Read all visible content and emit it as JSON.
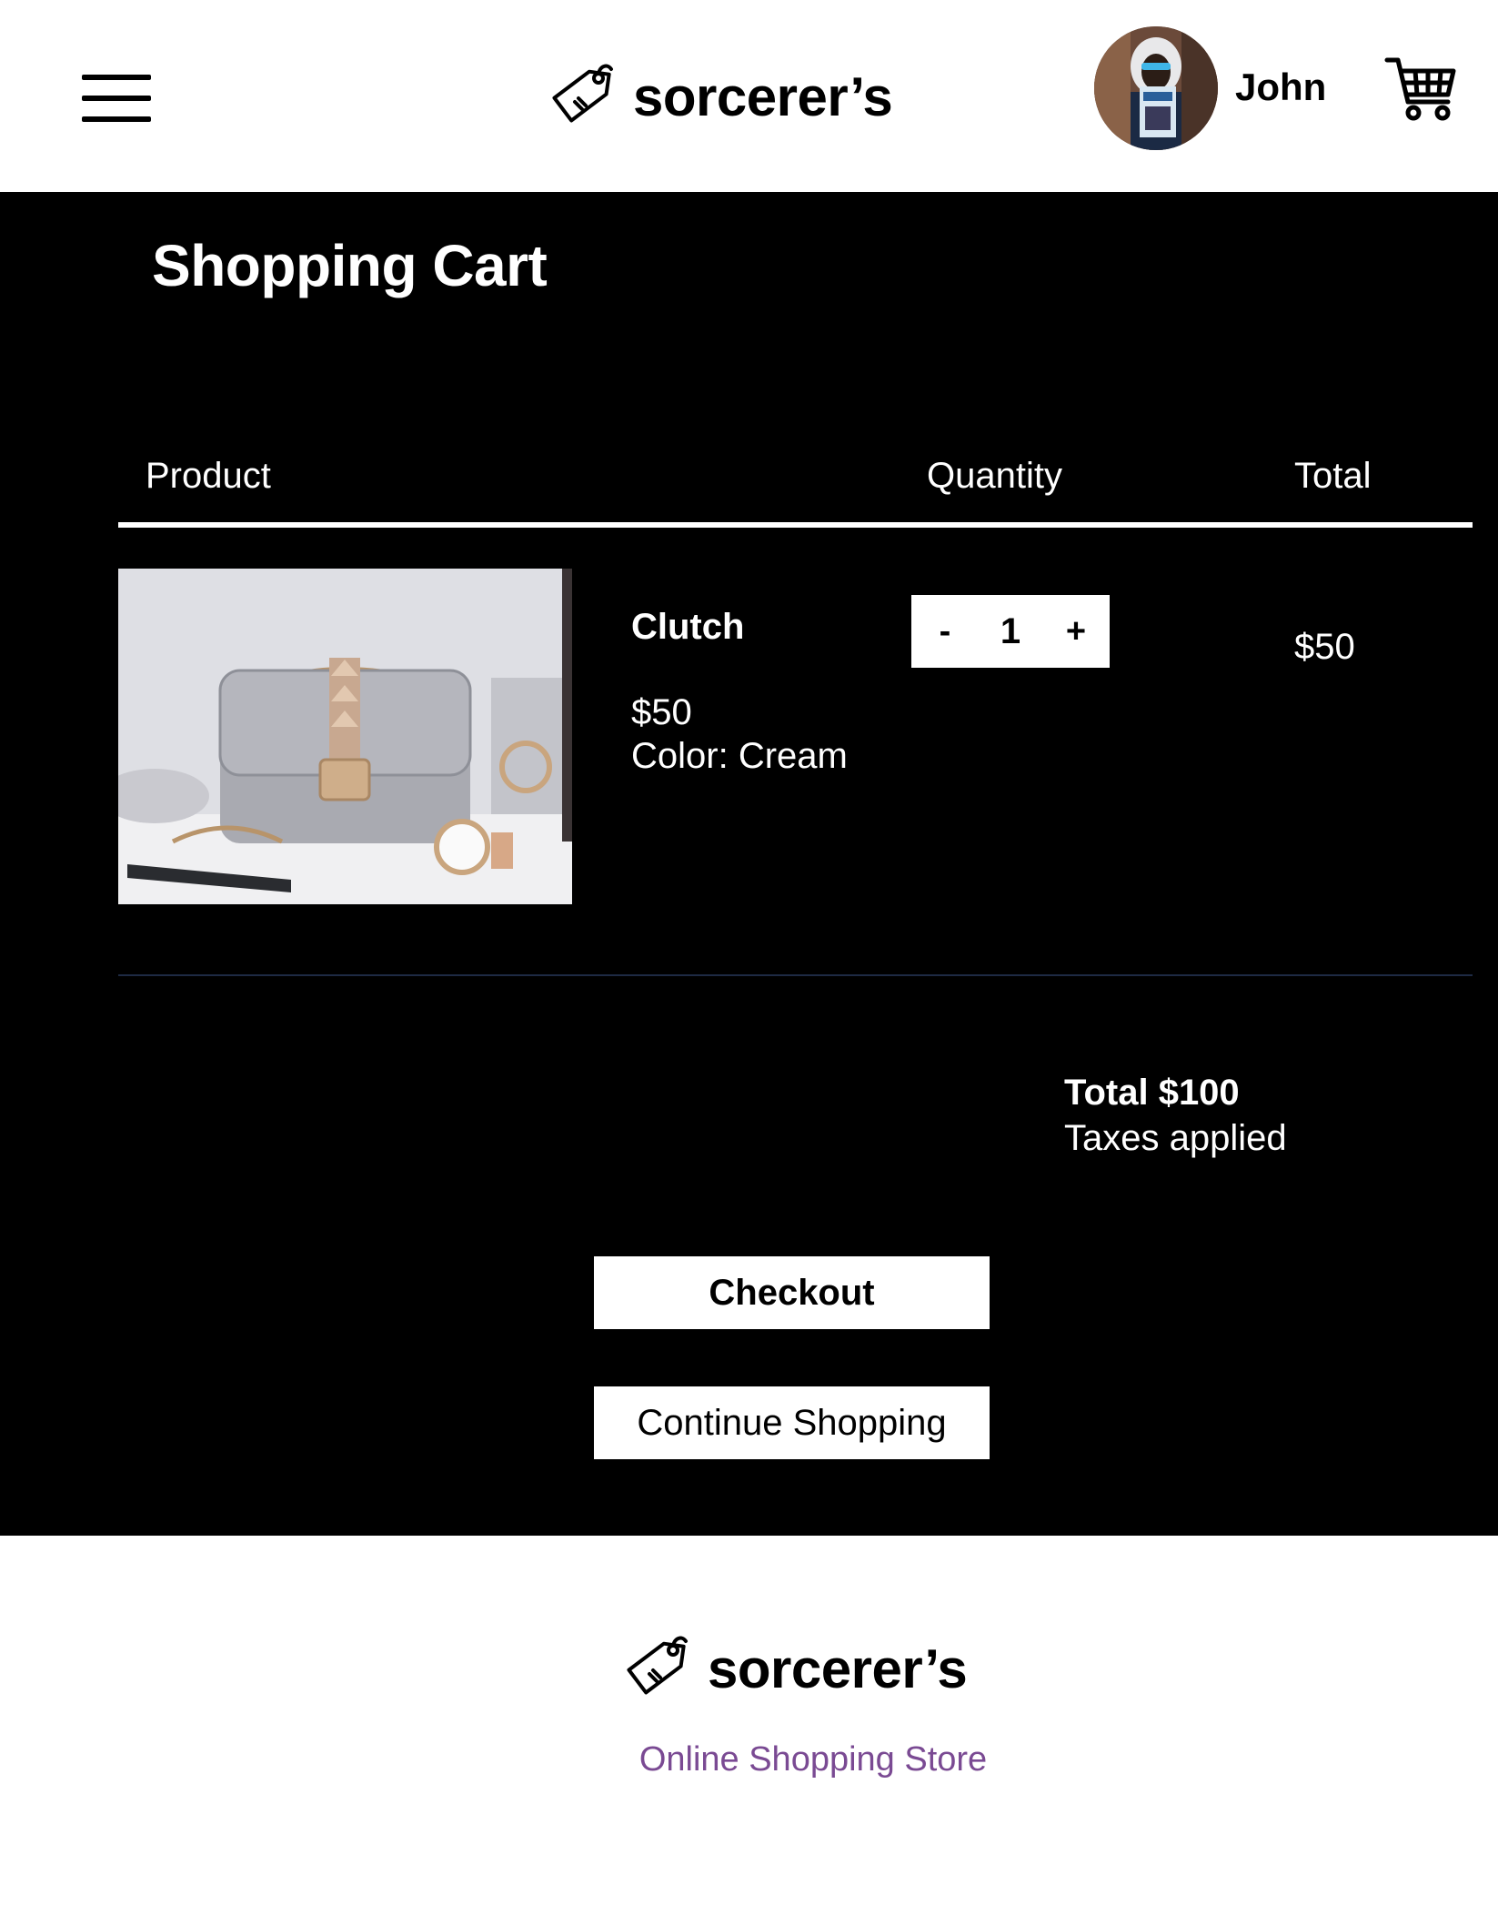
{
  "header": {
    "brand_name": "sorcerer’s",
    "user_name": "John"
  },
  "cart": {
    "title": "Shopping Cart",
    "columns": {
      "product": "Product",
      "quantity": "Quantity",
      "total": "Total"
    },
    "items": [
      {
        "name": "Clutch",
        "price": "$50",
        "color": "Color: Cream",
        "quantity": "1",
        "decrement_label": "-",
        "increment_label": "+",
        "line_total": "$50"
      }
    ],
    "summary": {
      "total": "Total $100",
      "taxes_note": "Taxes applied"
    },
    "checkout_label": "Checkout",
    "continue_label": "Continue Shopping"
  },
  "footer": {
    "brand_name": "sorcerer’s",
    "tagline": "Online Shopping Store"
  },
  "colors": {
    "header_bg": "#ffffff",
    "main_bg": "#000000",
    "tagline": "#7a4a93",
    "item_divider": "#1e2a44"
  },
  "icons": {
    "menu": "hamburger-menu-icon",
    "brand": "price-tag-icon",
    "cart": "shopping-cart-icon"
  }
}
